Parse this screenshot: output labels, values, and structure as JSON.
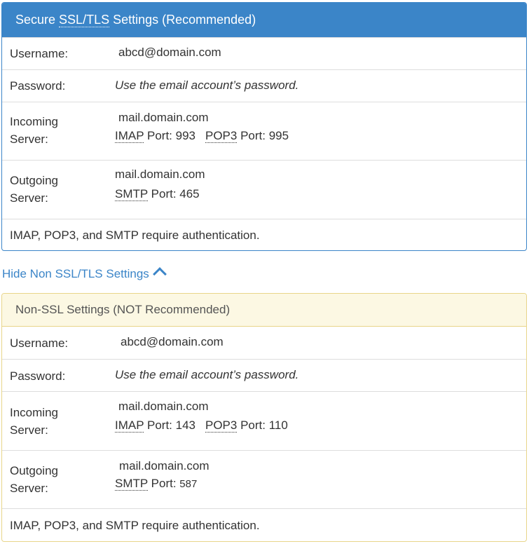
{
  "ssl": {
    "heading_pre": "Secure ",
    "heading_abbr": "SSL/TLS",
    "heading_post": " Settings (Recommended)",
    "username_label": "Username:",
    "username_value": "abcd@domain.com",
    "password_label": "Password:",
    "password_value": "Use the email account’s password.",
    "incoming_label_1": "Incoming",
    "incoming_label_2": "Server:",
    "incoming_server": "mail.domain.com",
    "imap_abbr": "IMAP",
    "imap_port": " Port: 993",
    "pop3_abbr": "POP3",
    "pop3_port": " Port: 995",
    "outgoing_label_1": "Outgoing",
    "outgoing_label_2": "Server:",
    "outgoing_server": "mail.domain.com",
    "smtp_abbr": "SMTP",
    "smtp_port": " Port: 465",
    "auth_note": "IMAP, POP3, and SMTP require authentication."
  },
  "toggle_link": "Hide Non SSL/TLS Settings",
  "nonssl": {
    "heading": "Non-SSL Settings (NOT Recommended)",
    "username_label": "Username:",
    "username_value": "abcd@domain.com",
    "password_label": "Password:",
    "password_value": "Use the email account’s password.",
    "incoming_label_1": "Incoming",
    "incoming_label_2": "Server:",
    "incoming_server": "mail.domain.com",
    "imap_abbr": "IMAP",
    "imap_port": " Port: 143",
    "pop3_abbr": "POP3",
    "pop3_port": " Port: 110",
    "outgoing_label_1": "Outgoing",
    "outgoing_label_2": "Server:",
    "outgoing_server": "mail.domain.com",
    "smtp_abbr": "SMTP",
    "smtp_port_label": " Port: ",
    "smtp_port_value": "587",
    "auth_note": "IMAP, POP3, and SMTP require authentication."
  },
  "colors": {
    "primary": "#3b85c8",
    "warning_bg": "#fcf8e3",
    "warning_border": "#e8d58a"
  }
}
